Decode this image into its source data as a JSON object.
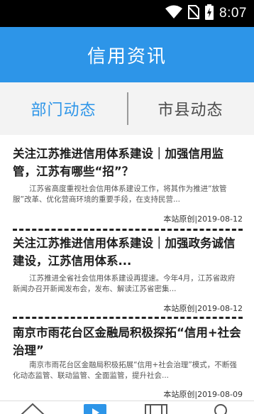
{
  "status_bar": {
    "time": "8:07",
    "icons": [
      "wifi-icon",
      "no-sim-icon",
      "battery-charging-icon"
    ]
  },
  "app_bar": {
    "title": "信用资讯"
  },
  "tabs": [
    {
      "label": "部门动态",
      "active": true
    },
    {
      "label": "市县动态",
      "active": false
    }
  ],
  "articles": [
    {
      "title": "关注江苏推进信用体系建设｜加强信用监管，江苏有哪些“招”？",
      "summary": "江苏省高度重视社会信用体系建设工作，将其作为推进“放管服”改革、优化营商环境的重要手段，在支持民营...",
      "meta": "本站原创|2019-08-12"
    },
    {
      "title": "关注江苏推进信用体系建设｜加强政务诚信建设，江苏信用体系...",
      "summary": "江苏推进全省社会信用体系建设再提速。今年4月，江苏省政府新闻办召开新闻发布会，发布、解读江苏省密集...",
      "meta": "本站原创|2019-08-12"
    },
    {
      "title": "南京市雨花台区金融局积极探拓“信用+社会治理”",
      "summary": "南京市雨花台区金融局积极拓展“信用+社会治理”模式，不断强化动态监管、联动监管、全面监管，提升社会...",
      "meta": "本站原创|2019-08-09"
    }
  ],
  "bottom_nav": [
    "home-icon",
    "play-icon",
    "table-icon",
    "user-icon"
  ],
  "colors": {
    "accent": "#2d95e8",
    "status_bar": "#000000",
    "tab_inactive": "#4a4a4a"
  }
}
